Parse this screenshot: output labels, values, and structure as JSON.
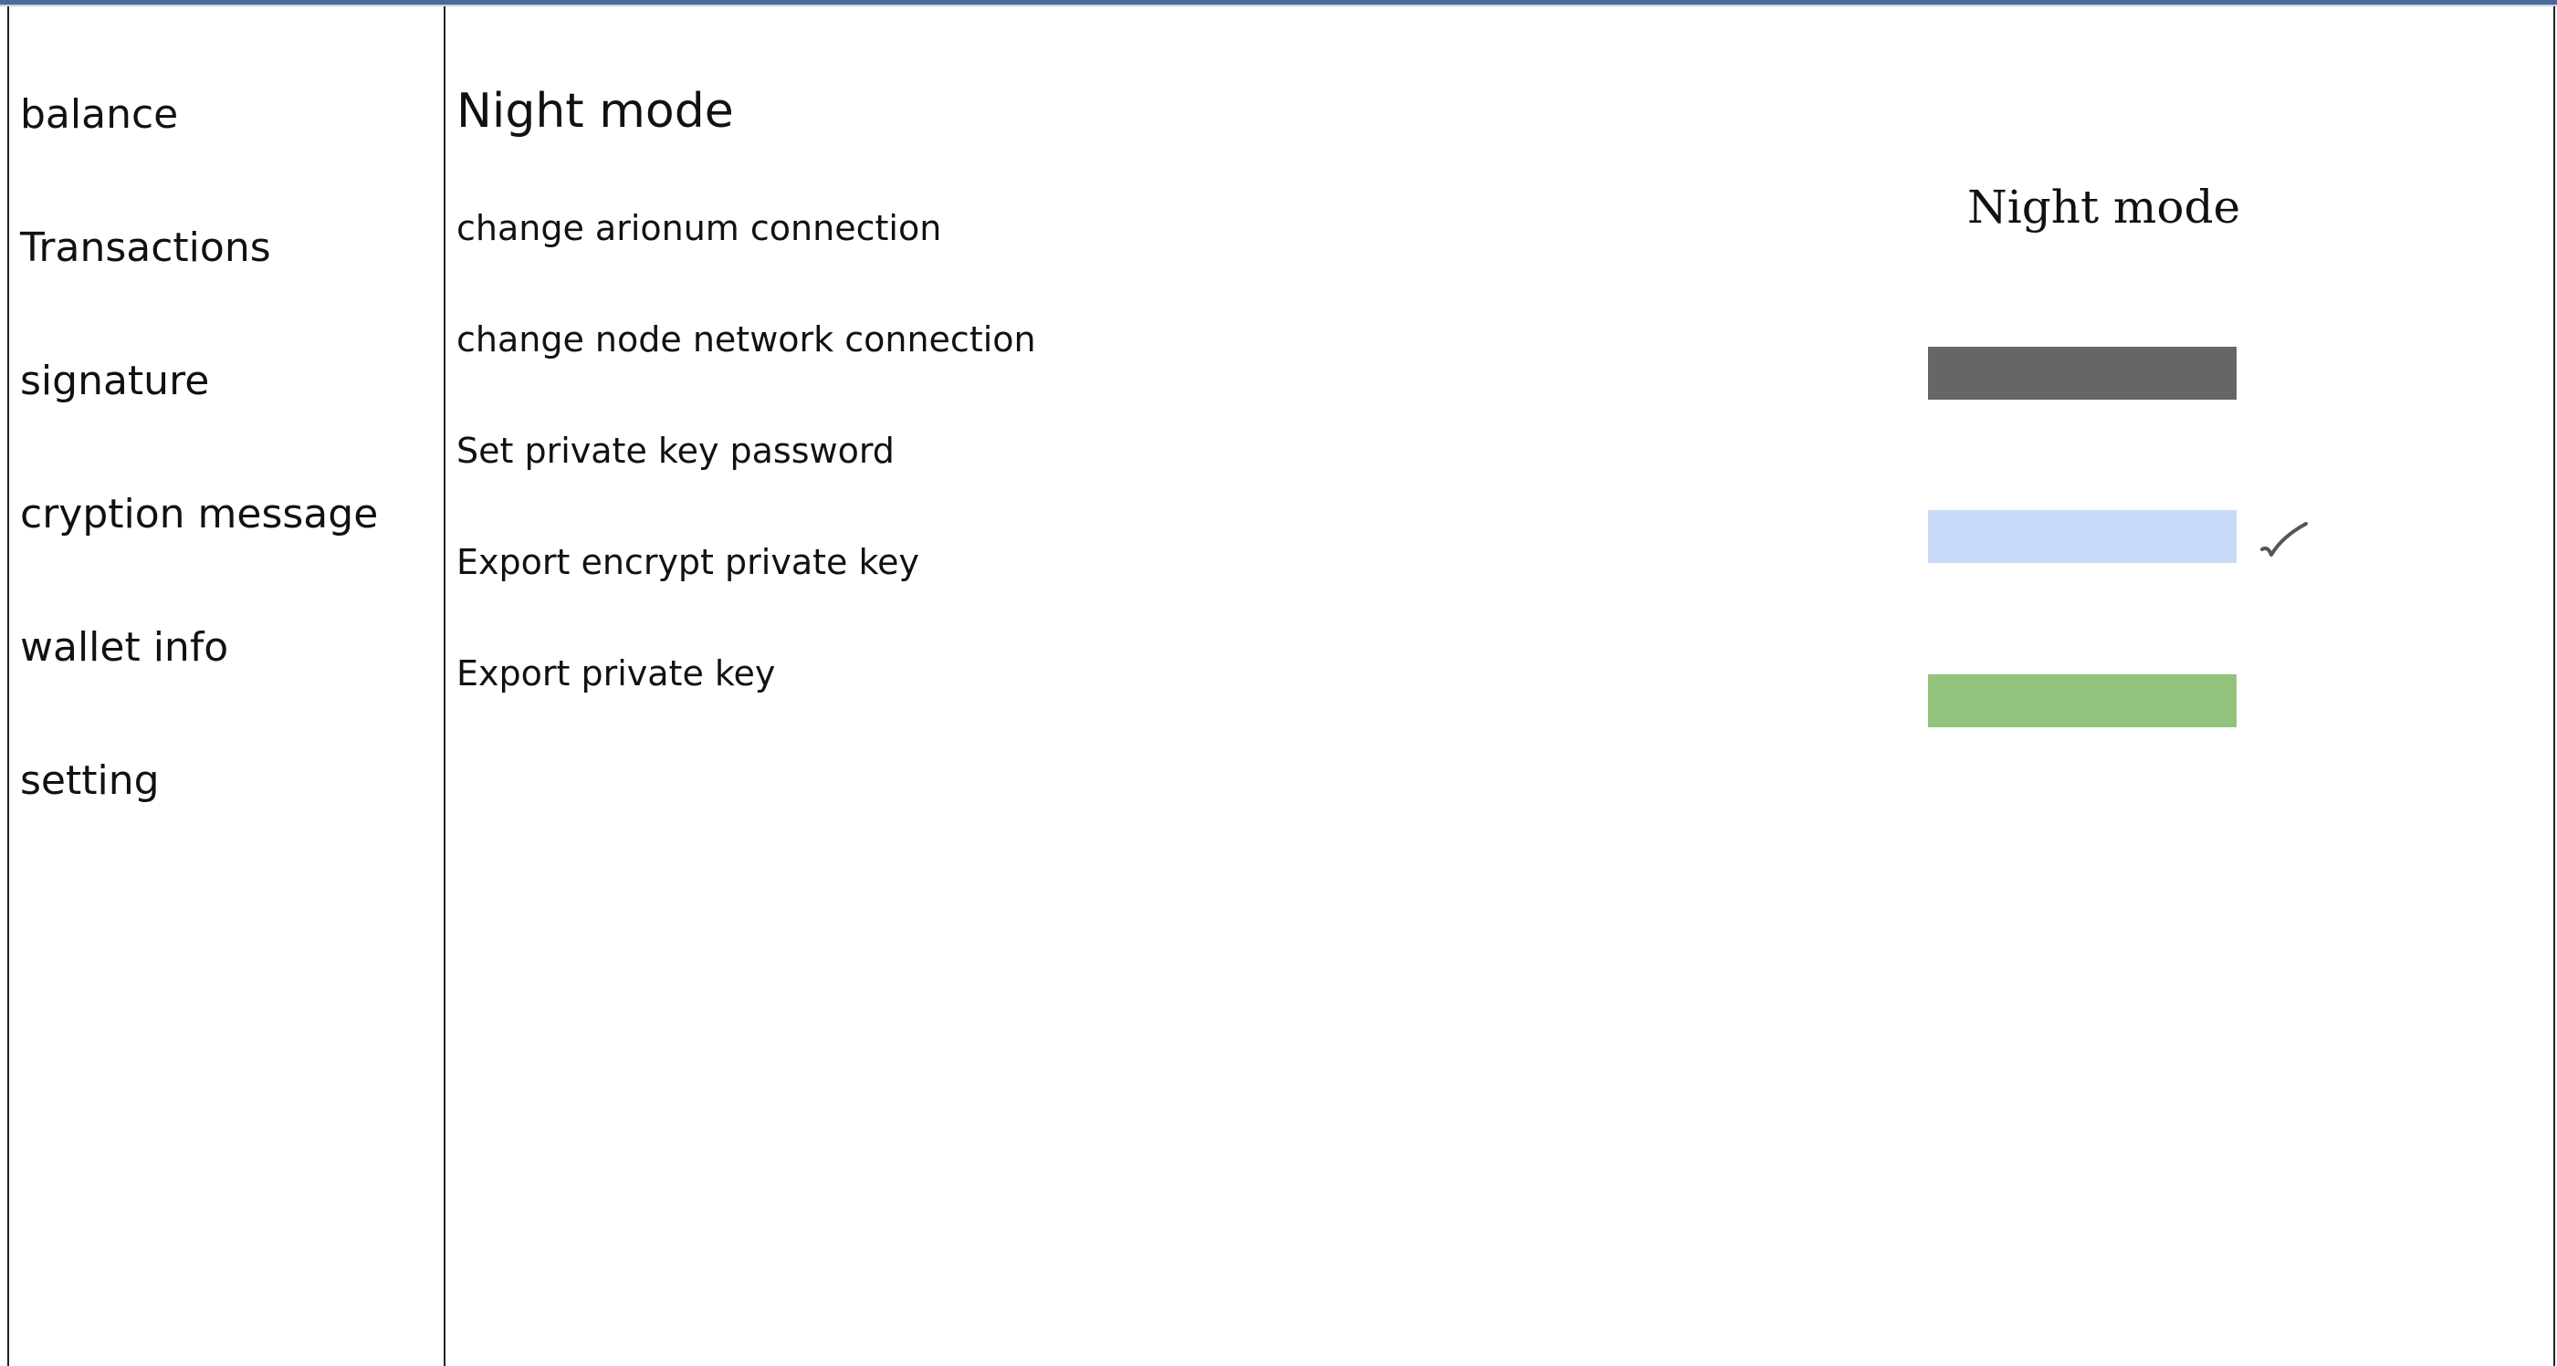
{
  "sidebar": {
    "items": [
      {
        "label": "balance"
      },
      {
        "label": "Transactions"
      },
      {
        "label": "signature"
      },
      {
        "label": "cryption message"
      },
      {
        "label": "wallet info"
      },
      {
        "label": "setting"
      }
    ]
  },
  "settings": {
    "title": "Night mode",
    "items": [
      {
        "label": "change arionum connection"
      },
      {
        "label": "change node network connection"
      },
      {
        "label": "Set private key password"
      },
      {
        "label": "Export encrypt  private key"
      },
      {
        "label": "Export private key"
      }
    ]
  },
  "night_mode_panel": {
    "title": "Night mode",
    "options": [
      {
        "color": "#666666",
        "selected": false
      },
      {
        "color": "#c9daf8",
        "selected": true
      },
      {
        "color": "#93c47d",
        "selected": false
      }
    ],
    "check_icon": "check-icon"
  }
}
